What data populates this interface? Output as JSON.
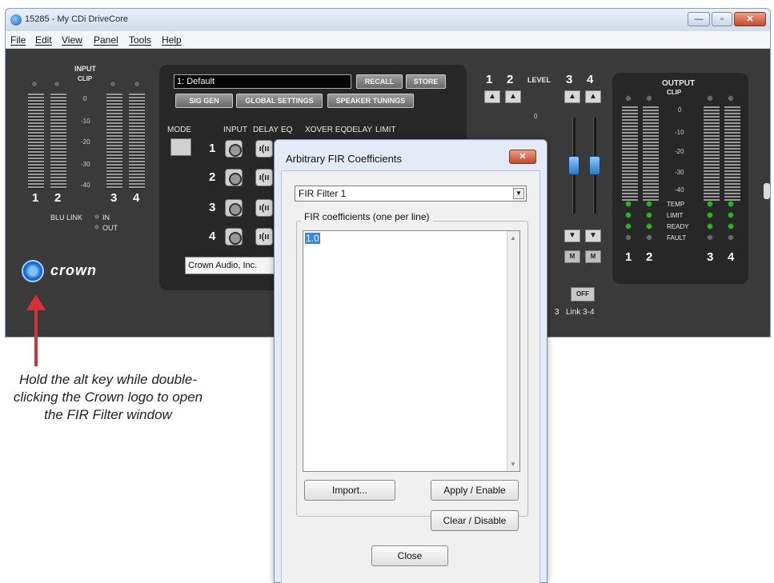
{
  "window": {
    "title": "15285 - My CDi DriveCore",
    "minimize_glyph": "—",
    "maximize_glyph": "▫",
    "close_glyph": "✕"
  },
  "menu": [
    "File",
    "Edit",
    "View",
    "Panel",
    "Tools",
    "Help"
  ],
  "input_section": {
    "title": "INPUT",
    "clip_label": "CLIP",
    "scale": [
      "0",
      "-10",
      "-20",
      "-30",
      "-40"
    ],
    "channels": [
      "1",
      "2",
      "3",
      "4"
    ],
    "blu_link_label": "BLU LINK",
    "blu_in": "IN",
    "blu_out": "OUT"
  },
  "logo": {
    "text": "crown"
  },
  "dsp": {
    "preset_value": "1: Default",
    "recall_label": "RECALL",
    "store_label": "STORE",
    "sig_gen_label": "SIG GEN",
    "global_settings_label": "GLOBAL SETTINGS",
    "speaker_tunings_label": "SPEAKER TUNINGS",
    "mode_label": "MODE",
    "headers": [
      "INPUT",
      "DELAY",
      "EQ",
      "XOVER EQ",
      "DELAY",
      "LIMIT"
    ],
    "rows": [
      "1",
      "2",
      "3",
      "4"
    ],
    "delay_glyph": "ı(ıı",
    "company_value": "Crown Audio, Inc."
  },
  "level_section": {
    "label": "LEVEL",
    "channels": [
      "1",
      "2",
      "3",
      "4"
    ],
    "scale": [
      "0"
    ],
    "up_glyph": "▲",
    "down_glyph": "▼",
    "mute_label": "M",
    "off_label": "OFF",
    "link_label": "Link 3-4",
    "partial_link_label": "3"
  },
  "output_section": {
    "title": "OUTPUT",
    "clip_label": "CLIP",
    "scale": [
      "0",
      "-10",
      "-20",
      "-30",
      "-40"
    ],
    "status_labels": [
      "TEMP",
      "LIMIT",
      "READY",
      "FAULT"
    ],
    "channels": [
      "1",
      "2",
      "3",
      "4"
    ]
  },
  "callout": {
    "text": "Hold the alt key while double-clicking the Crown logo to open the FIR Filter window",
    "arrow_color": "#d6303a"
  },
  "dialog": {
    "title": "Arbitrary FIR Coefficients",
    "close_glyph": "✕",
    "select_value": "FIR Filter 1",
    "select_arrow": "▼",
    "group_label": "FIR coefficients (one per line)",
    "textarea_value": "1.0",
    "scroll_up": "▲",
    "scroll_down": "▼",
    "import_label": "Import...",
    "apply_label": "Apply / Enable",
    "clear_label": "Clear / Disable",
    "close_label": "Close"
  },
  "colors": {
    "panel": "#3a3a3a",
    "accent_blue": "#2a78c8",
    "led_green": "#2fb32f",
    "selection": "#3b87d6"
  }
}
